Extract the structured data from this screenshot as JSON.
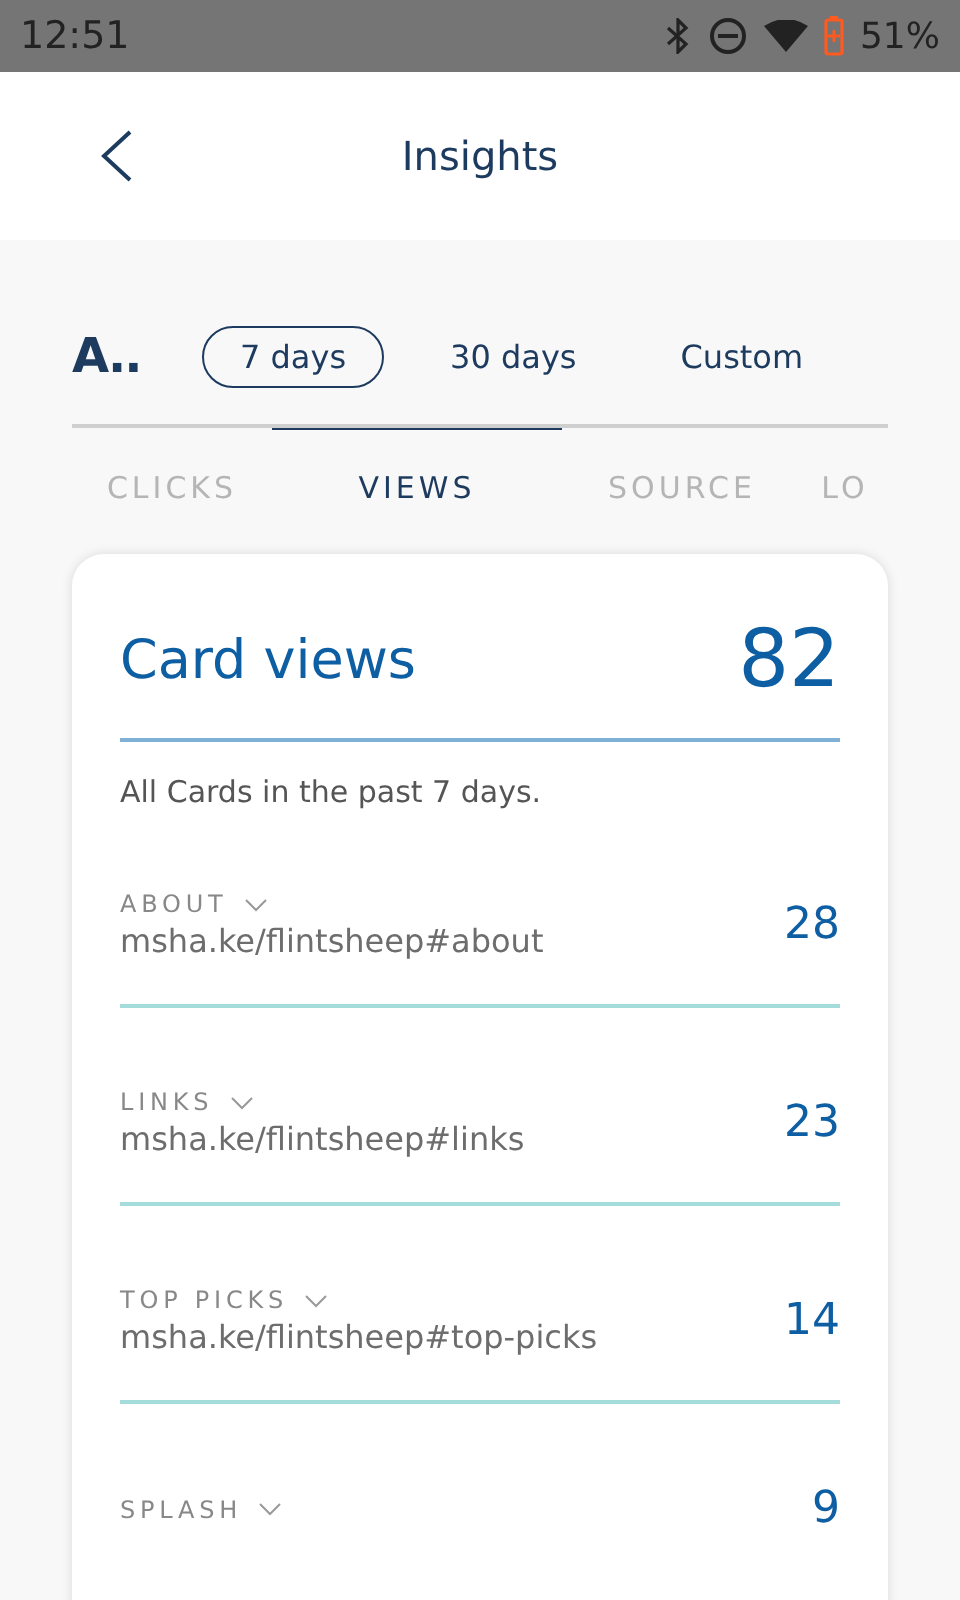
{
  "status_bar": {
    "time": "12:51",
    "battery": "51%"
  },
  "header": {
    "title": "Insights"
  },
  "periods": {
    "label": "A..",
    "options": [
      {
        "label": "7 days",
        "selected": true
      },
      {
        "label": "30 days",
        "selected": false
      },
      {
        "label": "Custom",
        "selected": false
      }
    ]
  },
  "tabs": [
    {
      "label": "CLICKS",
      "selected": false
    },
    {
      "label": "VIEWS",
      "selected": true
    },
    {
      "label": "SOURCE",
      "selected": false
    },
    {
      "label": "LO",
      "selected": false
    }
  ],
  "card": {
    "title": "Card views",
    "total": "82",
    "subtitle": "All Cards in the past 7 days.",
    "rows": [
      {
        "label": "ABOUT",
        "url": "msha.ke/flintsheep#about",
        "count": "28"
      },
      {
        "label": "LINKS",
        "url": "msha.ke/flintsheep#links",
        "count": "23"
      },
      {
        "label": "TOP PICKS",
        "url": "msha.ke/flintsheep#top-picks",
        "count": "14"
      },
      {
        "label": "SPLASH",
        "count": "9"
      }
    ]
  }
}
